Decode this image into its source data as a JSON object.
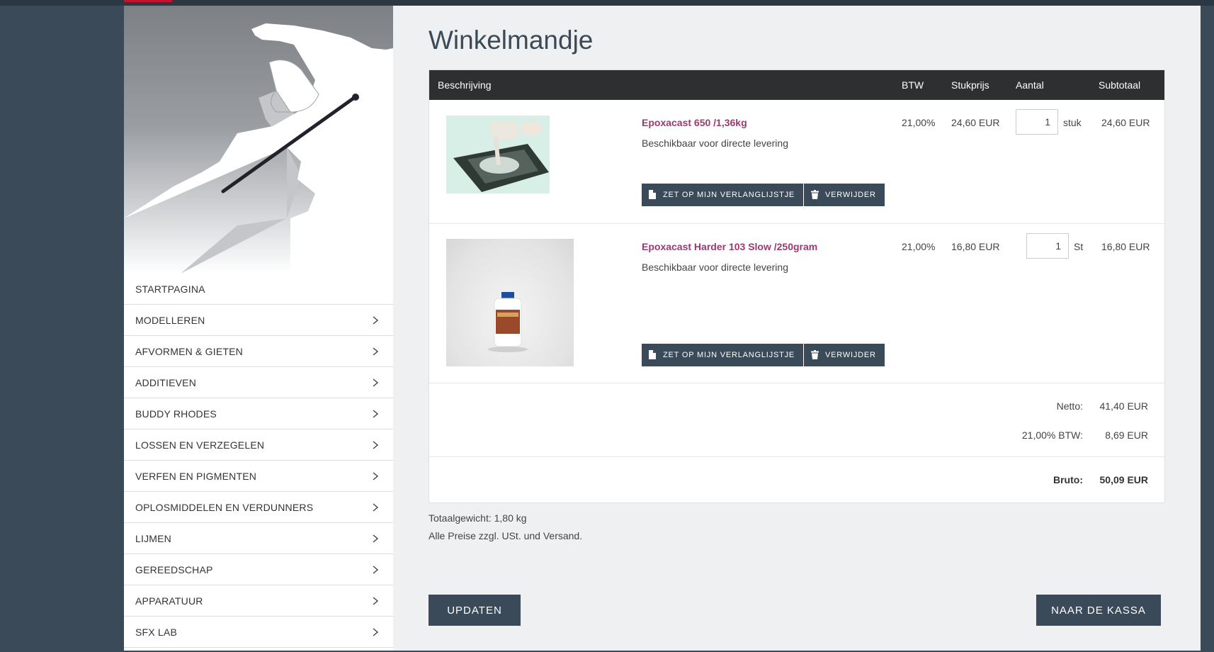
{
  "page_title": "Winkelmandje",
  "sidebar": {
    "items": [
      {
        "label": "STARTPAGINA",
        "has_chevron": false
      },
      {
        "label": "MODELLEREN",
        "has_chevron": true
      },
      {
        "label": "AFVORMEN & GIETEN",
        "has_chevron": true
      },
      {
        "label": "ADDITIEVEN",
        "has_chevron": true
      },
      {
        "label": "BUDDY RHODES",
        "has_chevron": true
      },
      {
        "label": "LOSSEN EN VERZEGELEN",
        "has_chevron": true
      },
      {
        "label": "VERFEN EN PIGMENTEN",
        "has_chevron": true
      },
      {
        "label": "OPLOSMIDDELEN EN VERDUNNERS",
        "has_chevron": true
      },
      {
        "label": "LIJMEN",
        "has_chevron": true
      },
      {
        "label": "GEREEDSCHAP",
        "has_chevron": true
      },
      {
        "label": "APPARATUUR",
        "has_chevron": true
      },
      {
        "label": "SFX LAB",
        "has_chevron": true
      }
    ]
  },
  "cart": {
    "headers": {
      "description": "Beschrijving",
      "vat": "BTW",
      "unit_price": "Stukprijs",
      "quantity": "Aantal",
      "subtotal": "Subtotaal"
    },
    "items": [
      {
        "name": "Epoxacast 650 /1,36kg",
        "availability": "Beschikbaar voor directe levering",
        "vat": "21,00%",
        "unit_price": "24,60 EUR",
        "quantity": "1",
        "unit": "stuk",
        "subtotal": "24,60 EUR",
        "wishlist_label": "ZET OP MIJN VERLANGLIJSTJE",
        "remove_label": "VERWIJDER"
      },
      {
        "name": "Epoxacast Harder 103 Slow /250gram",
        "availability": "Beschikbaar voor directe levering",
        "vat": "21,00%",
        "unit_price": "16,80 EUR",
        "quantity": "1",
        "unit": "St",
        "subtotal": "16,80 EUR",
        "wishlist_label": "ZET OP MIJN VERLANGLIJSTJE",
        "remove_label": "VERWIJDER"
      }
    ],
    "totals": {
      "net_label": "Netto:",
      "net_value": "41,40 EUR",
      "vat_label": "21,00% BTW:",
      "vat_value": "8,69 EUR",
      "gross_label": "Bruto:",
      "gross_value": "50,09 EUR"
    }
  },
  "footer": {
    "total_weight": "Totaalgewicht: 1,80 kg",
    "price_note": "Alle Preise zzgl. USt. und Versand.",
    "update_label": "UPDATEN",
    "checkout_label": "NAAR DE KASSA"
  }
}
